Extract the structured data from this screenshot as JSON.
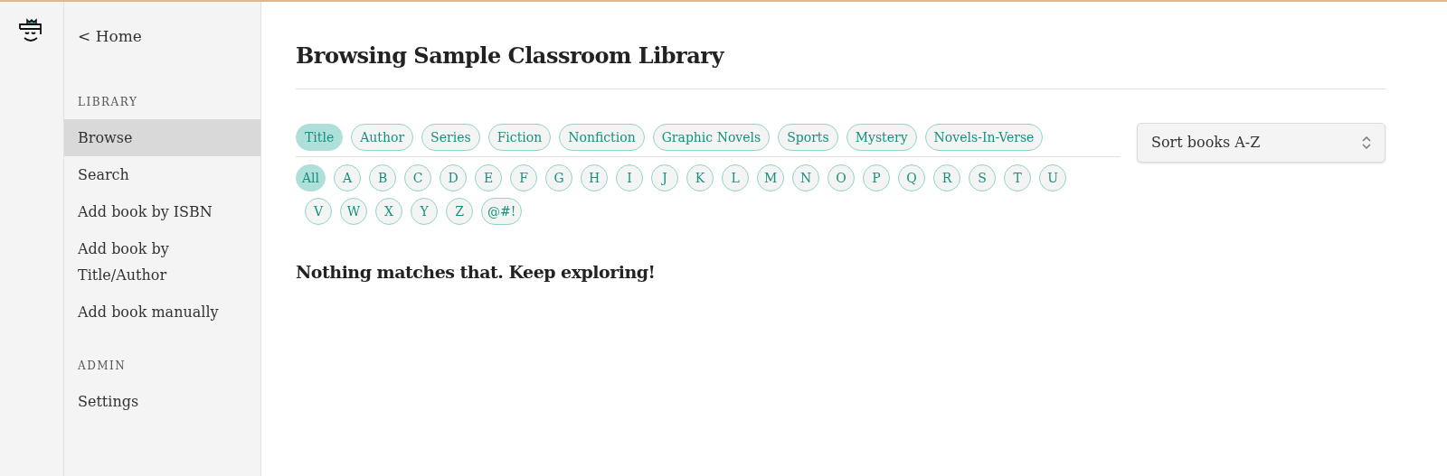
{
  "sidebar": {
    "home_link": "< Home",
    "sections": [
      {
        "heading": "LIBRARY",
        "items": [
          {
            "label": "Browse",
            "selected": true
          },
          {
            "label": "Search",
            "selected": false
          },
          {
            "label": "Add book by ISBN",
            "selected": false
          },
          {
            "label": "Add book by Title/Author",
            "selected": false
          },
          {
            "label": "Add book manually",
            "selected": false
          }
        ]
      },
      {
        "heading": "ADMIN",
        "items": [
          {
            "label": "Settings",
            "selected": false
          }
        ]
      }
    ]
  },
  "page_title": "Browsing Sample Classroom Library",
  "filter_tabs": [
    {
      "label": "Title",
      "selected": true
    },
    {
      "label": "Author",
      "selected": false
    },
    {
      "label": "Series",
      "selected": false
    },
    {
      "label": "Fiction",
      "selected": false
    },
    {
      "label": "Nonfiction",
      "selected": false
    },
    {
      "label": "Graphic Novels",
      "selected": false
    },
    {
      "label": "Sports",
      "selected": false
    },
    {
      "label": "Mystery",
      "selected": false
    },
    {
      "label": "Novels-In-Verse",
      "selected": false
    }
  ],
  "letters": [
    {
      "label": "All",
      "selected": true
    },
    {
      "label": "A",
      "selected": false
    },
    {
      "label": "B",
      "selected": false
    },
    {
      "label": "C",
      "selected": false
    },
    {
      "label": "D",
      "selected": false
    },
    {
      "label": "E",
      "selected": false
    },
    {
      "label": "F",
      "selected": false
    },
    {
      "label": "G",
      "selected": false
    },
    {
      "label": "H",
      "selected": false
    },
    {
      "label": "I",
      "selected": false
    },
    {
      "label": "J",
      "selected": false
    },
    {
      "label": "K",
      "selected": false
    },
    {
      "label": "L",
      "selected": false
    },
    {
      "label": "M",
      "selected": false
    },
    {
      "label": "N",
      "selected": false
    },
    {
      "label": "O",
      "selected": false
    },
    {
      "label": "P",
      "selected": false
    },
    {
      "label": "Q",
      "selected": false
    },
    {
      "label": "R",
      "selected": false
    },
    {
      "label": "S",
      "selected": false
    },
    {
      "label": "T",
      "selected": false
    },
    {
      "label": "U",
      "selected": false
    },
    {
      "label": "V",
      "selected": false
    },
    {
      "label": "W",
      "selected": false
    },
    {
      "label": "X",
      "selected": false
    },
    {
      "label": "Y",
      "selected": false
    },
    {
      "label": "Z",
      "selected": false
    },
    {
      "label": "@#!",
      "selected": false
    }
  ],
  "sort_select": {
    "value": "Sort books A-Z"
  },
  "empty_message": "Nothing matches that. Keep exploring!"
}
